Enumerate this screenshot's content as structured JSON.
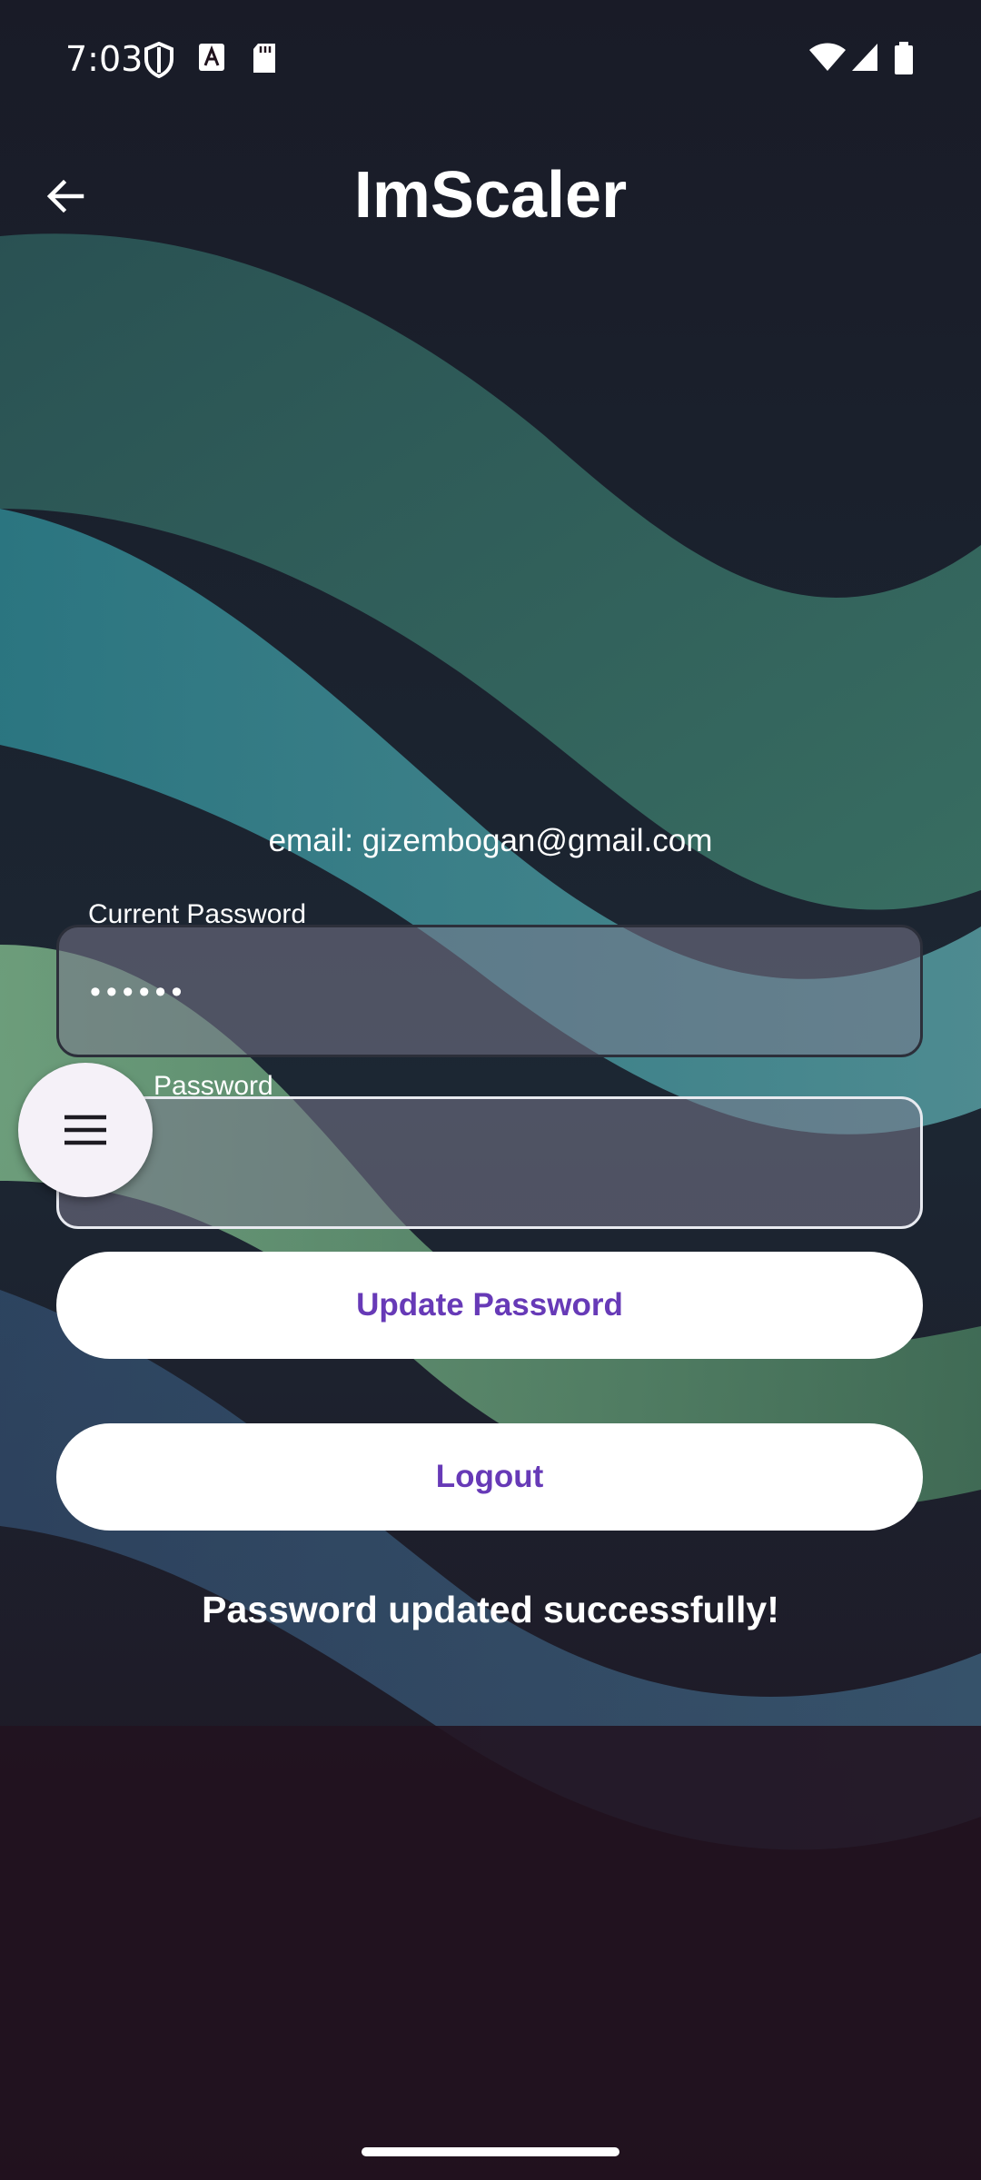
{
  "status_bar": {
    "time": "7:03",
    "left_icons": [
      "shield-icon",
      "text-a-icon",
      "sd-card-icon"
    ],
    "right_icons": [
      "wifi-icon",
      "cell-signal-icon",
      "battery-icon"
    ]
  },
  "app_bar": {
    "title": "ImScaler",
    "back_icon": "arrow-left-icon"
  },
  "profile": {
    "email_text": "email: gizembogan@gmail.com"
  },
  "form": {
    "current_password": {
      "label": "Current Password",
      "value": "••••••"
    },
    "new_password": {
      "label": "Password",
      "value": "•••"
    },
    "update_button": "Update Password",
    "logout_button": "Logout"
  },
  "message": "Password updated successfully!",
  "fab": {
    "icon": "menu-icon"
  },
  "colors": {
    "accent": "#673ab7",
    "background": "#20121d",
    "fab": "#f5f1f8"
  }
}
